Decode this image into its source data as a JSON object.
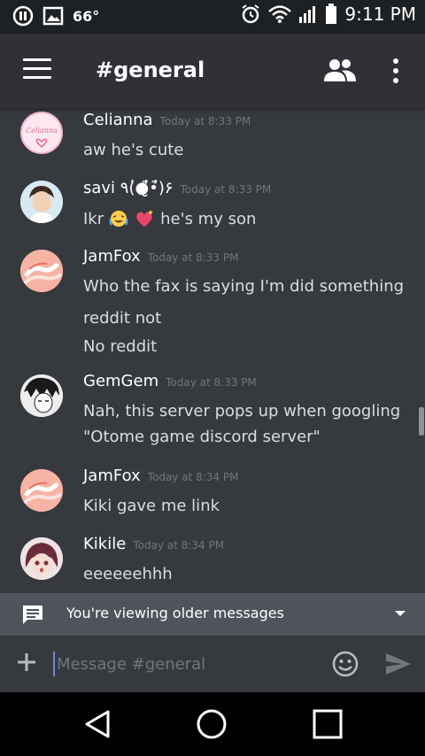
{
  "status_bar": {
    "temperature": "66°",
    "time": "9:11 PM",
    "icons": [
      "record-icon",
      "image-icon",
      "alarm-icon",
      "wifi-icon",
      "signal-icon",
      "battery-icon"
    ]
  },
  "header": {
    "channel_title": "#general",
    "icons": [
      "menu-icon",
      "members-icon",
      "more-icon"
    ]
  },
  "messages": [
    {
      "username": "Celianna",
      "timestamp": "Today at 8:33 PM",
      "lines": [
        "aw he's cute"
      ],
      "avatar_text": "Celianna"
    },
    {
      "username": "savi ٩(̾●̮̮̃̾•̃̾)۶",
      "timestamp": "Today at 8:33 PM",
      "lines": [
        "Ikr",
        "he's my son"
      ],
      "emojis": [
        "laughing-crying-emoji",
        "sparkling-heart-emoji"
      ]
    },
    {
      "username": "JamFox",
      "timestamp": "Today at 8:33 PM",
      "lines": [
        "Who the fax is saying I'm did something",
        "reddit not",
        "No reddit"
      ]
    },
    {
      "username": "GemGem",
      "timestamp": "Today at 8:33 PM",
      "lines": [
        "Nah, this server pops up when googling",
        "\"Otome game discord server\""
      ]
    },
    {
      "username": "JamFox",
      "timestamp": "Today at 8:34 PM",
      "lines": [
        "Kiki gave me link"
      ]
    },
    {
      "username": "Kikile",
      "timestamp": "Today at 8:34 PM",
      "lines": [
        "eeeeeehhh"
      ]
    }
  ],
  "older_banner": {
    "text": "You're viewing older messages"
  },
  "composer": {
    "placeholder": "Message #general"
  },
  "nav": [
    "back-icon",
    "home-icon",
    "recents-icon"
  ],
  "colors": {
    "background": "#36393e",
    "header": "#2f3136",
    "accent": "#7289da",
    "banner": "#4f545c"
  }
}
